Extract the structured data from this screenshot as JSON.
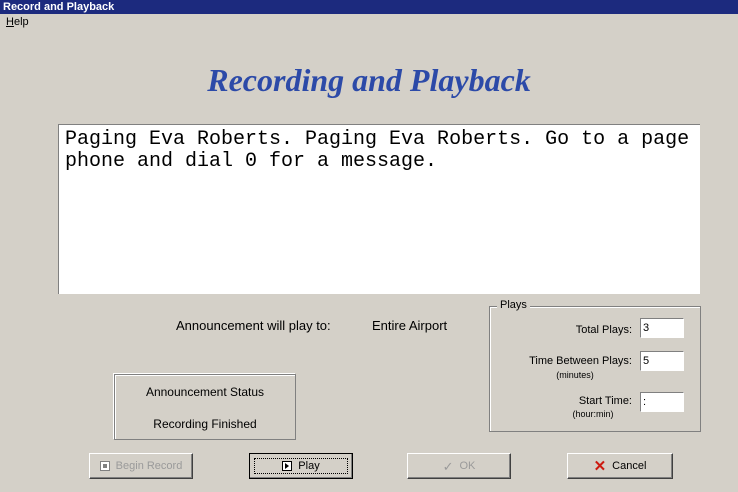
{
  "window": {
    "title": "Record and Playback"
  },
  "menu": {
    "help_mnemonic": "H",
    "help_rest": "elp"
  },
  "heading": "Recording and Playback",
  "message": "Paging Eva Roberts. Paging Eva Roberts. Go to a page phone and dial 0 for a message.",
  "announcement": {
    "label": "Announcement will play to:",
    "target": "Entire Airport"
  },
  "plays": {
    "legend": "Plays",
    "total_label": "Total Plays:",
    "total_value": "3",
    "between_label": "Time Between Plays:",
    "between_unit": "(minutes)",
    "between_value": "5",
    "start_label": "Start Time:",
    "start_unit": "(hour:min)",
    "start_value": ":"
  },
  "status": {
    "title": "Announcement Status",
    "value": "Recording Finished"
  },
  "buttons": {
    "begin_record": "Begin Record",
    "play": "Play",
    "ok": "OK",
    "cancel": "Cancel"
  },
  "colors": {
    "title_bar": "#1c2a7e",
    "heading": "#2c4aa8",
    "cancel_icon": "#cc1a10"
  },
  "icons": {
    "begin_record": "record-icon",
    "play": "play-icon",
    "ok": "check-icon",
    "cancel": "x-icon"
  }
}
